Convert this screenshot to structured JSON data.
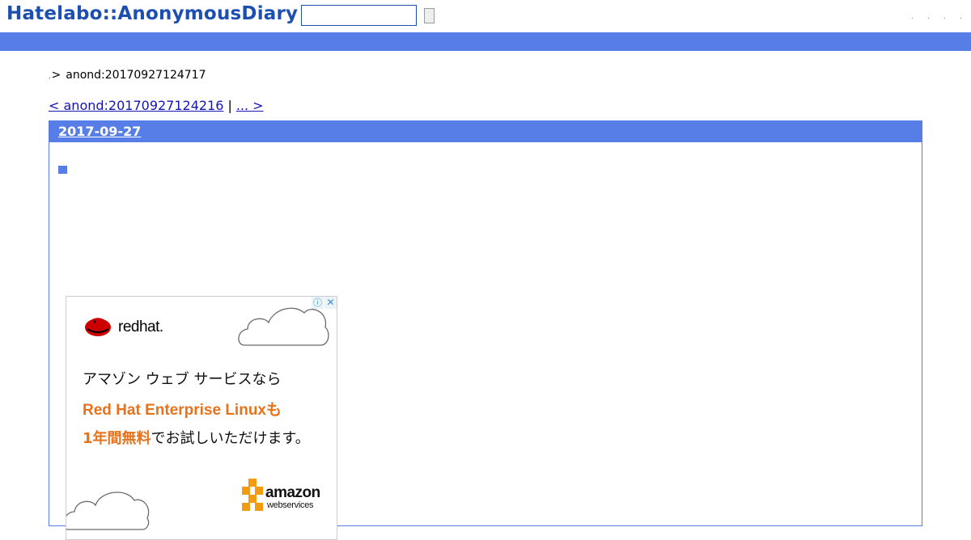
{
  "header": {
    "site_title": "Hatelabo::AnonymousDiary",
    "search_value": "",
    "nav_dots": [
      ".",
      ".",
      ".",
      "."
    ]
  },
  "breadcrumb": {
    "home": ".",
    "separator": ">",
    "current": "anond:20170927124717"
  },
  "pager": {
    "prev": "< anond:20170927124216",
    "divider": "|",
    "next": "... > "
  },
  "day": {
    "date": "2017-09-27",
    "entry_anchor": "■"
  },
  "ad": {
    "info_icon": "info-icon",
    "close_icon": "close-icon",
    "brand": "redhat.",
    "line1": "アマゾン ウェブ サービスなら",
    "line2": "Red Hat Enterprise Linuxも",
    "line3_highlight": "1年間無料",
    "line3_rest": "でお試しいただけます。",
    "aws_brand": "amazon",
    "aws_sub": "webservices"
  },
  "colors": {
    "title_blue": "#1d4fb1",
    "bar_blue": "#577de7",
    "link_blue": "#1414b3",
    "ad_orange": "#e8721c"
  }
}
